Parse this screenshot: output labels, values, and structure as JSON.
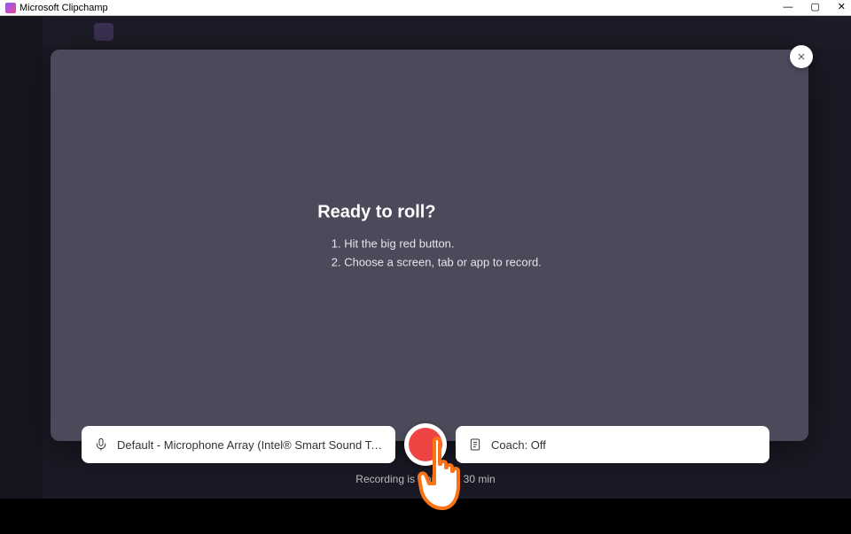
{
  "window": {
    "title": "Microsoft Clipchamp"
  },
  "modal": {
    "heading": "Ready to roll?",
    "step1": "Hit the big red button.",
    "step2": "Choose a screen, tab or app to record."
  },
  "controls": {
    "mic_label": "Default - Microphone Array (Intel® Smart Sound Technology for Di...",
    "coach_label": "Coach: Off"
  },
  "footer": {
    "limit_text": "Recording is limited to 30 min"
  }
}
